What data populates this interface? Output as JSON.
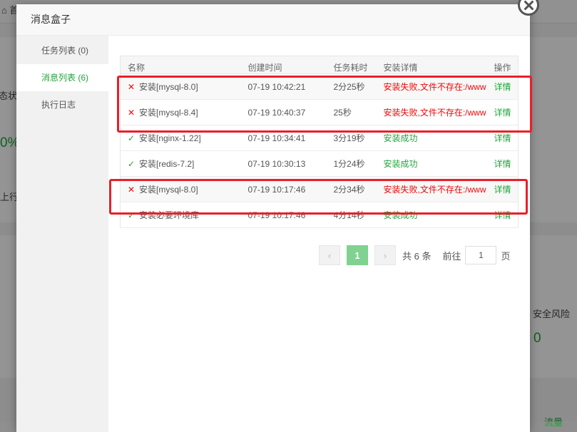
{
  "background": {
    "fragments": [
      "⌂ 首",
      "态状",
      "0%",
      "上行流",
      "安全风险",
      "0",
      "流量"
    ]
  },
  "modal": {
    "title": "消息盒子",
    "sidebar": [
      {
        "label": "任务列表 (0)",
        "active": false
      },
      {
        "label": "消息列表 (6)",
        "active": true
      },
      {
        "label": "执行日志",
        "active": false
      }
    ],
    "table": {
      "headers": {
        "name": "名称",
        "created": "创建时间",
        "duration": "任务耗时",
        "detail": "安装详情",
        "action": "操作"
      },
      "rows": [
        {
          "status": "fail",
          "icon": "✕",
          "name": "安装[mysql-8.0]",
          "created": "07-19 10:42:21",
          "duration": "2分25秒",
          "detail": "安装失败,文件不存在:/www",
          "action": "详情"
        },
        {
          "status": "fail",
          "icon": "✕",
          "name": "安装[mysql-8.4]",
          "created": "07-19 10:40:37",
          "duration": "25秒",
          "detail": "安装失败,文件不存在:/www",
          "action": "详情"
        },
        {
          "status": "ok",
          "icon": "✓",
          "name": "安装[nginx-1.22]",
          "created": "07-19 10:34:41",
          "duration": "3分19秒",
          "detail": "安装成功",
          "action": "详情"
        },
        {
          "status": "ok",
          "icon": "✓",
          "name": "安装[redis-7.2]",
          "created": "07-19 10:30:13",
          "duration": "1分24秒",
          "detail": "安装成功",
          "action": "详情"
        },
        {
          "status": "fail",
          "icon": "✕",
          "name": "安装[mysql-8.0]",
          "created": "07-19 10:17:46",
          "duration": "2分34秒",
          "detail": "安装失败,文件不存在:/www",
          "action": "详情"
        },
        {
          "status": "ok",
          "icon": "✓",
          "name": "安装必要环境库",
          "created": "07-19 10:17:46",
          "duration": "4分14秒",
          "detail": "安装成功",
          "action": "详情"
        }
      ]
    },
    "pager": {
      "prev": "‹",
      "current": "1",
      "next": "›",
      "total": "共 6 条",
      "goto_prefix": "前往",
      "goto_value": "1",
      "goto_suffix": "页"
    }
  },
  "colors": {
    "accent": "#20a53a",
    "error": "#ef0808",
    "highlight": "#e91f29"
  }
}
